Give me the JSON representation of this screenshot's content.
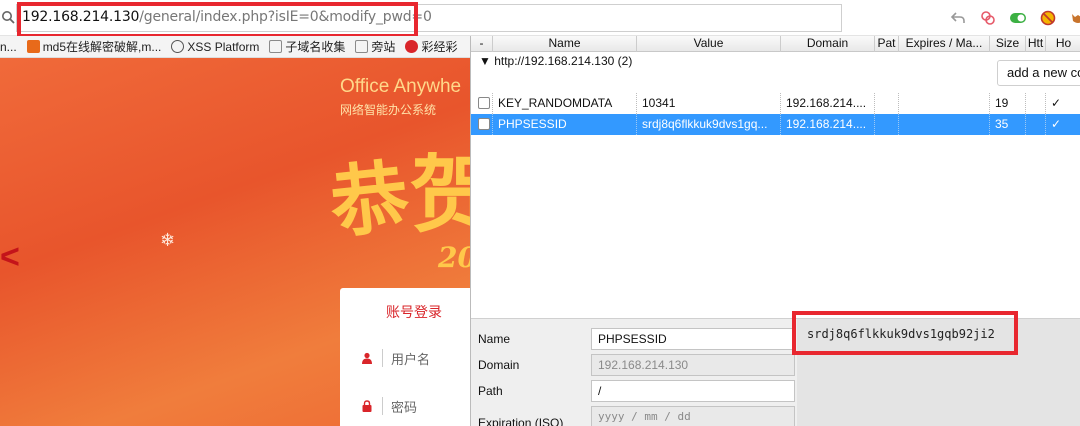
{
  "browser": {
    "url_host": "192.168.214.130",
    "url_path": "/general/index.php?isIE=0&modify_pwd=0",
    "toolbar_icons": [
      "back-arrow-icon",
      "extension-icon",
      "toggle-icon",
      "block-icon",
      "fox-icon"
    ]
  },
  "bookmarks": [
    {
      "label": "n...",
      "icon": "bookmark-icon",
      "color": "#777777"
    },
    {
      "label": "md5在线解密破解,m...",
      "icon": "md5-icon",
      "color": "#e86a1a"
    },
    {
      "label": "XSS Platform",
      "icon": "globe-icon",
      "color": "#555555"
    },
    {
      "label": "子域名收集",
      "icon": "folder-icon",
      "color": "#8a8a8a"
    },
    {
      "label": "旁站",
      "icon": "folder-icon",
      "color": "#8a8a8a"
    },
    {
      "label": "彩经彩",
      "icon": "logo-icon",
      "color": "#d9252a"
    }
  ],
  "webpage": {
    "brand_title": "Office Anywhe",
    "brand_subtitle": "网络智能办公系统",
    "greeting_chars": [
      "恭",
      "贺"
    ],
    "year_partial": "20",
    "login_tab": "账号登录",
    "username_placeholder": "用户名",
    "password_placeholder": "密码"
  },
  "cookie_panel": {
    "columns": [
      "-",
      "Name",
      "Value",
      "Domain",
      "Pat",
      "Expires / Ma...",
      "Size",
      "Htt",
      "Ho"
    ],
    "group_label": "▼ http://192.168.214.130 (2)",
    "add_button": "add a new co",
    "rows": [
      {
        "name": "KEY_RANDOMDATA",
        "value": "10341",
        "domain": "192.168.214....",
        "path": "",
        "expires": "",
        "size": "19",
        "http": "",
        "host": "✓",
        "selected": false
      },
      {
        "name": "PHPSESSID",
        "value": "srdj8q6flkkuk9dvs1gq...",
        "domain": "192.168.214....",
        "path": "",
        "expires": "",
        "size": "35",
        "http": "",
        "host": "✓",
        "selected": true
      }
    ],
    "details": {
      "name_label": "Name",
      "name_value": "PHPSESSID",
      "domain_label": "Domain",
      "domain_value": "192.168.214.130",
      "path_label": "Path",
      "path_value": "/",
      "expiration_label": "Expiration (ISO)",
      "expiration_placeholder": "yyyy / mm / dd"
    },
    "value_full": "srdj8q6flkkuk9dvs1gqb92ji2"
  },
  "colors": {
    "highlight_red": "#e8272f",
    "selected_row": "#3399ff",
    "page_orange": "#ee6a34"
  }
}
